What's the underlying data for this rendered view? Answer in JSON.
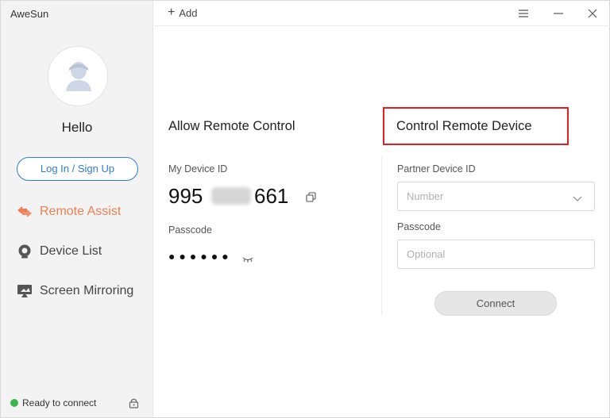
{
  "app": {
    "title": "AweSun"
  },
  "sidebar": {
    "greeting": "Hello",
    "login_label": "Log In / Sign Up",
    "items": [
      {
        "label": "Remote Assist",
        "icon": "remote-assist-icon",
        "active": true
      },
      {
        "label": "Device List",
        "icon": "device-list-icon",
        "active": false
      },
      {
        "label": "Screen Mirroring",
        "icon": "screen-mirroring-icon",
        "active": false
      }
    ],
    "status": "Ready to connect"
  },
  "topbar": {
    "add_label": "Add"
  },
  "allow": {
    "title": "Allow Remote Control",
    "device_id_label": "My Device ID",
    "device_id_start": "995",
    "device_id_end": "661",
    "passcode_label": "Passcode",
    "passcode_masked": "●●●●●●"
  },
  "control": {
    "title": "Control Remote Device",
    "partner_label": "Partner Device ID",
    "partner_placeholder": "Number",
    "passcode_label": "Passcode",
    "passcode_placeholder": "Optional",
    "connect_label": "Connect"
  },
  "colors": {
    "accent": "#2f7bd6",
    "active_nav": "#ef7f52",
    "status_green": "#3cb64a",
    "highlight": "#e02020"
  }
}
